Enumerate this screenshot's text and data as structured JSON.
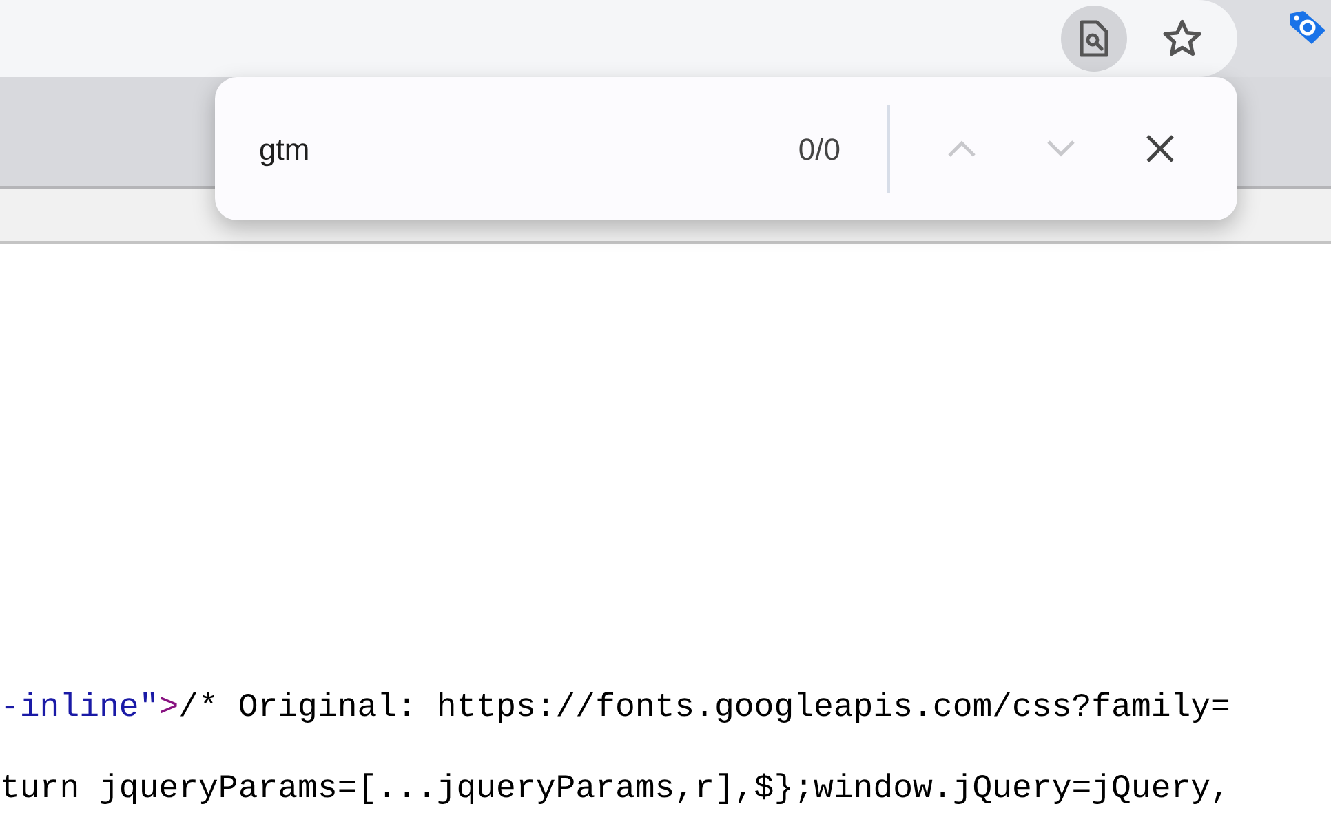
{
  "find_bar": {
    "query": "gtm",
    "match_count": "0/0",
    "previous_disabled": true,
    "next_disabled": true
  },
  "toolbar": {
    "page_search_active": true
  },
  "source_lines": [
    [
      {
        "kind": "attr_value",
        "text": "-inline\""
      },
      {
        "kind": "tag",
        "text": ">"
      },
      {
        "kind": "plain",
        "text": "/* Original: https://fonts.googleapis.com/css?family="
      }
    ],
    [
      {
        "kind": "plain",
        "text": "turn jqueryParams=[...jqueryParams,r],$};window.jQuery=jQuery,"
      }
    ]
  ]
}
